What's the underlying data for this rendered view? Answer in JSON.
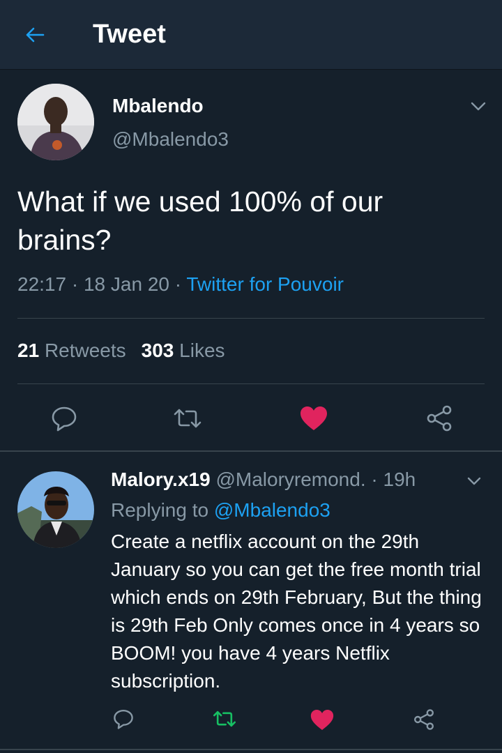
{
  "header": {
    "title": "Tweet",
    "back_icon": "arrow-left-icon"
  },
  "tweet": {
    "author_name": "Mbalendo",
    "author_handle": "@Mbalendo3",
    "text": "What if we used 100% of our brains?",
    "time": "22:17",
    "date": "18 Jan 20",
    "source": "Twitter for Pouvoir",
    "retweets_count": "21",
    "retweets_label": "Retweets",
    "likes_count": "303",
    "likes_label": "Likes",
    "liked": true
  },
  "reply": {
    "author_name": "Malory.x19",
    "author_handle": "@Maloryremond.",
    "time_ago": "19h",
    "replying_label": "Replying to",
    "replying_to": "@Mbalendo3",
    "text": "Create a netflix account on the 29th January so you can get the free month trial which ends on 29th February, But the thing is 29th Feb Only comes once in 4 years so BOOM! you have 4 years Netflix subscription.",
    "retweeted": true,
    "liked": true
  },
  "colors": {
    "background": "#15202b",
    "header": "#1c2938",
    "accent": "#1da1f2",
    "like": "#e0245e",
    "retweet": "#17bf63",
    "muted": "#8899a6"
  },
  "icons": [
    "arrow-left-icon",
    "chevron-down-icon",
    "reply-icon",
    "retweet-icon",
    "heart-icon",
    "share-icon"
  ]
}
